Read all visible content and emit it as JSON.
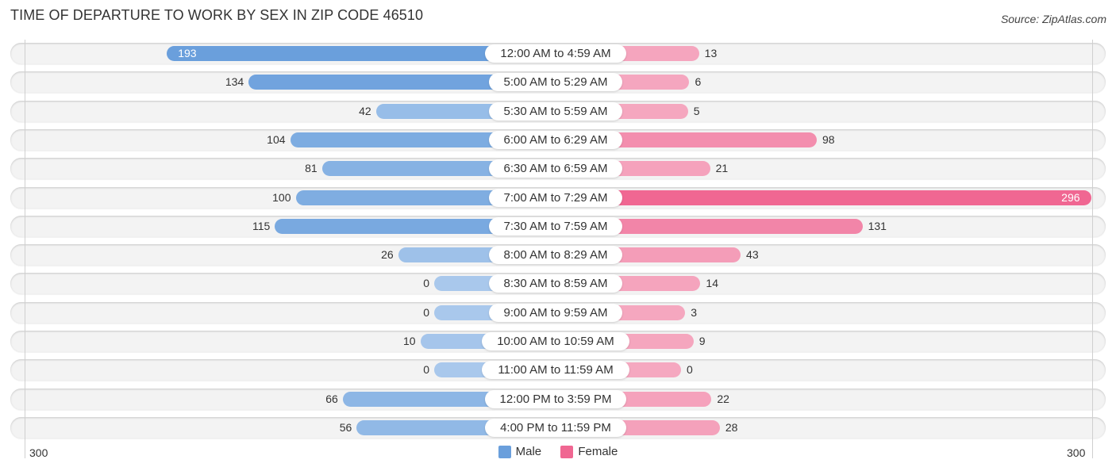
{
  "title": "TIME OF DEPARTURE TO WORK BY SEX IN ZIP CODE 46510",
  "source": "Source: ZipAtlas.com",
  "colors": {
    "male": "#6a9fdc",
    "male_light": "#a9c8ec",
    "female": "#f06792",
    "female_light": "#f5a8c0",
    "track": "#f3f3f3"
  },
  "chart_data": {
    "type": "bar",
    "orientation": "horizontal-diverging",
    "title": "TIME OF DEPARTURE TO WORK BY SEX IN ZIP CODE 46510",
    "categories": [
      "12:00 AM to 4:59 AM",
      "5:00 AM to 5:29 AM",
      "5:30 AM to 5:59 AM",
      "6:00 AM to 6:29 AM",
      "6:30 AM to 6:59 AM",
      "7:00 AM to 7:29 AM",
      "7:30 AM to 7:59 AM",
      "8:00 AM to 8:29 AM",
      "8:30 AM to 8:59 AM",
      "9:00 AM to 9:59 AM",
      "10:00 AM to 10:59 AM",
      "11:00 AM to 11:59 AM",
      "12:00 PM to 3:59 PM",
      "4:00 PM to 11:59 PM"
    ],
    "series": [
      {
        "name": "Male",
        "side": "left",
        "values": [
          193,
          134,
          42,
          104,
          81,
          100,
          115,
          26,
          0,
          0,
          10,
          0,
          66,
          56
        ]
      },
      {
        "name": "Female",
        "side": "right",
        "values": [
          13,
          6,
          5,
          98,
          21,
          296,
          131,
          43,
          14,
          3,
          9,
          0,
          22,
          28
        ]
      }
    ],
    "axis": {
      "left_tick": "300",
      "right_tick": "300",
      "range": [
        0,
        300
      ]
    },
    "legend": {
      "position": "bottom-center",
      "entries": [
        "Male",
        "Female"
      ]
    },
    "grid": false
  }
}
